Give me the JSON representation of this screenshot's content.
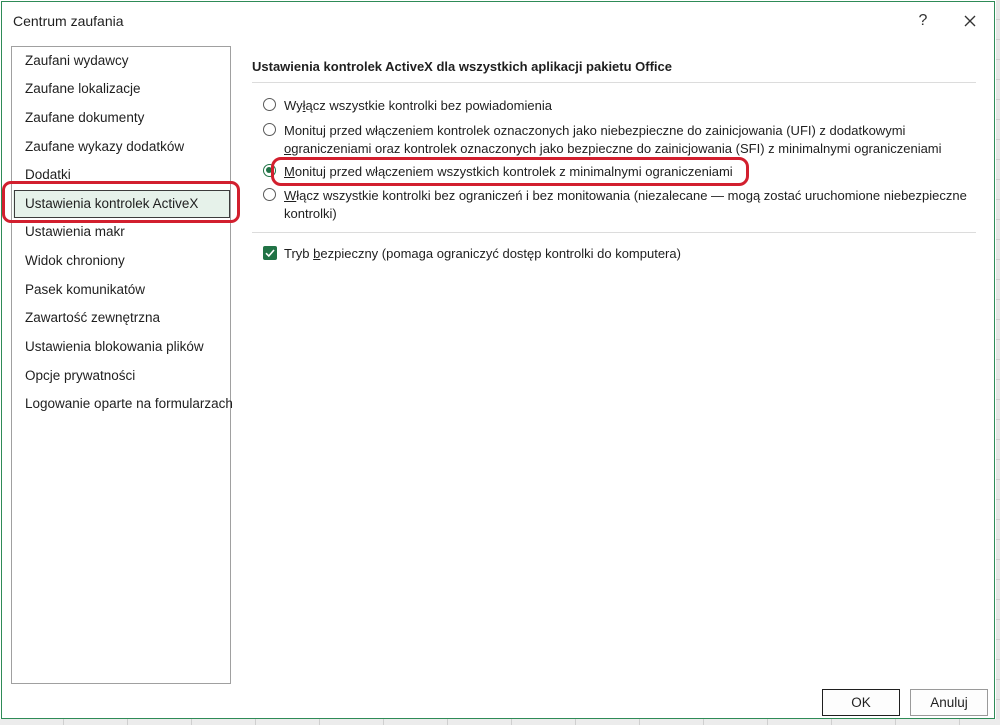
{
  "window": {
    "title": "Centrum zaufania",
    "help_label": "?"
  },
  "sidebar": {
    "items": [
      {
        "label": "Zaufani wydawcy"
      },
      {
        "label": "Zaufane lokalizacje"
      },
      {
        "label": "Zaufane dokumenty"
      },
      {
        "label": "Zaufane wykazy dodatków"
      },
      {
        "label": "Dodatki"
      },
      {
        "label": "Ustawienia kontrolek ActiveX",
        "selected": true
      },
      {
        "label": "Ustawienia makr"
      },
      {
        "label": "Widok chroniony"
      },
      {
        "label": "Pasek komunikatów"
      },
      {
        "label": "Zawartość zewnętrzna"
      },
      {
        "label": "Ustawienia blokowania plików"
      },
      {
        "label": "Opcje prywatności"
      },
      {
        "label": "Logowanie oparte na formularzach"
      }
    ]
  },
  "main": {
    "section_title": "Ustawienia kontrolek ActiveX dla wszystkich aplikacji pakietu Office",
    "options": [
      {
        "pre": "Wy",
        "key": "ł",
        "post": "ącz wszystkie kontrolki bez powiadomienia",
        "checked": false
      },
      {
        "pre": "Monituj przed włączeniem kontrolek oznaczonych jako niebezpieczne do zainicjowania (UFI) z dodatkowymi ",
        "key": "",
        "post": "",
        "line2_pre": "",
        "line2_key": "o",
        "line2_post": "graniczeniami oraz kontrolek oznaczonych jako bezpieczne do zainicjowania (SFI) z minimalnymi ograniczeniami",
        "checked": false
      },
      {
        "pre": "",
        "key": "M",
        "post": "onituj przed włączeniem wszystkich kontrolek z minimalnymi ograniczeniami",
        "checked": true
      },
      {
        "pre": "",
        "key": "W",
        "post": "łącz wszystkie kontrolki bez ograniczeń i bez monitowania (niezalecane — mogą zostać uruchomione niebezpieczne",
        "line2": "kontrolki)",
        "checked": false
      }
    ],
    "safe_mode": {
      "pre": "Tryb ",
      "key": "b",
      "post": "ezpieczny (pomaga ograniczyć dostęp kontrolki do komputera)",
      "checked": true
    }
  },
  "buttons": {
    "ok": "OK",
    "cancel": "Anuluj"
  },
  "colors": {
    "accent": "#217346",
    "highlight_ring": "#d21f2e",
    "selected_bg": "#e6f2ea"
  }
}
